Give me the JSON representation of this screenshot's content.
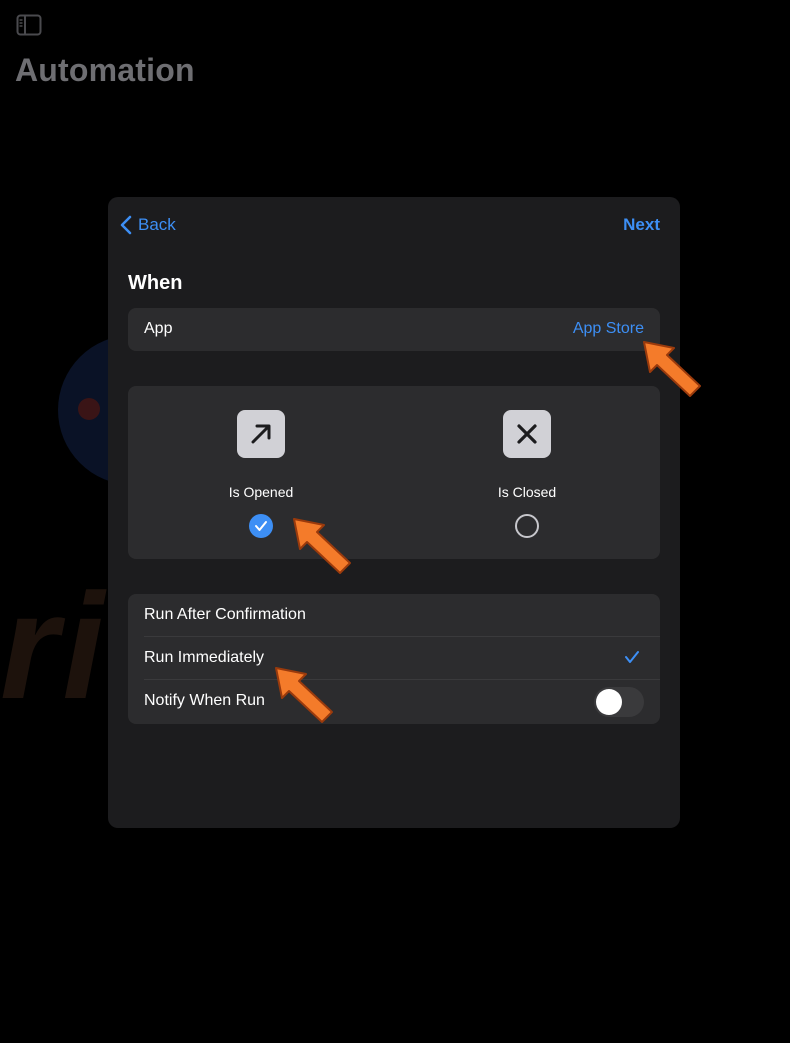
{
  "page": {
    "title": "Automation",
    "watermark_text": "risk.com"
  },
  "modal": {
    "back_label": "Back",
    "next_label": "Next",
    "section_title": "When",
    "app_row": {
      "label": "App",
      "value": "App Store"
    },
    "options": [
      {
        "label": "Is Opened",
        "icon": "arrow-up-right-icon",
        "selected": true
      },
      {
        "label": "Is Closed",
        "icon": "x-mark-icon",
        "selected": false
      }
    ],
    "run_options": [
      {
        "label": "Run After Confirmation",
        "checked": false
      },
      {
        "label": "Run Immediately",
        "checked": true
      },
      {
        "label": "Notify When Run",
        "toggle": false
      }
    ]
  },
  "colors": {
    "accent": "#3d8ff5",
    "annotation_arrow": "#f47b2a",
    "modal_bg": "#1c1c1e",
    "card_bg": "#2c2c2e",
    "title_gray": "#6e6e72"
  }
}
